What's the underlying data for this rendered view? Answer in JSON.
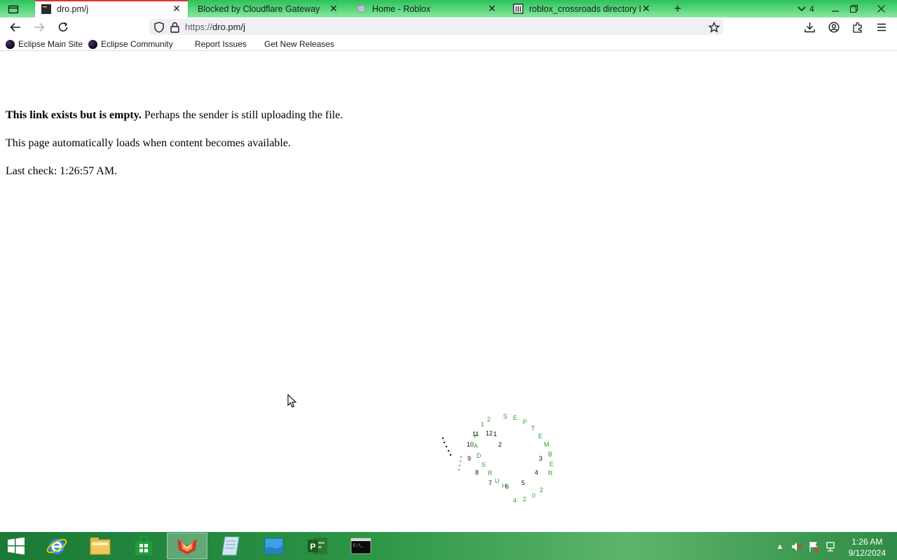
{
  "tabs": [
    {
      "title": "dro.pm/j",
      "active": true
    },
    {
      "title": "Blocked by Cloudflare Gateway",
      "active": false
    },
    {
      "title": "Home - Roblox",
      "active": false
    },
    {
      "title": "roblox_crossroads directory listi",
      "active": false
    }
  ],
  "tab_count": "4",
  "address_bar": {
    "scheme": "https://",
    "host": "dro.pm/j"
  },
  "bookmarks": [
    "Eclipse Main Site",
    "Eclipse Community",
    "Report Issues",
    "Get New Releases"
  ],
  "page": {
    "bold_lead": "This link exists but is empty.",
    "lead_rest": " Perhaps the sender is still uploading the file.",
    "line2": "This page automatically loads when content becomes available.",
    "last_check": "Last check: 1:26:57 AM."
  },
  "clock_widget": {
    "numbers": [
      "12",
      "1",
      "2",
      "3",
      "4",
      "5",
      "6",
      "7",
      "8",
      "9",
      "10",
      "11"
    ],
    "date_letters": [
      "S",
      "E",
      "P",
      "T",
      "E",
      "M",
      "B",
      "E",
      "R",
      "2",
      "0",
      "2",
      "4",
      "H",
      "U",
      "R",
      "S",
      "D",
      "A",
      "Y",
      "1",
      "2"
    ]
  },
  "taskbar": {
    "time": "1:26 AM",
    "date": "9/12/2024",
    "apps": [
      "start-button",
      "internet-explorer",
      "file-explorer",
      "store",
      "browser",
      "notepad",
      "network",
      "project",
      "command-prompt"
    ]
  },
  "colors": {
    "accent_green": "#2fc05e",
    "active_tab_line": "#e2332f",
    "clock_green": "#2ea12e"
  }
}
